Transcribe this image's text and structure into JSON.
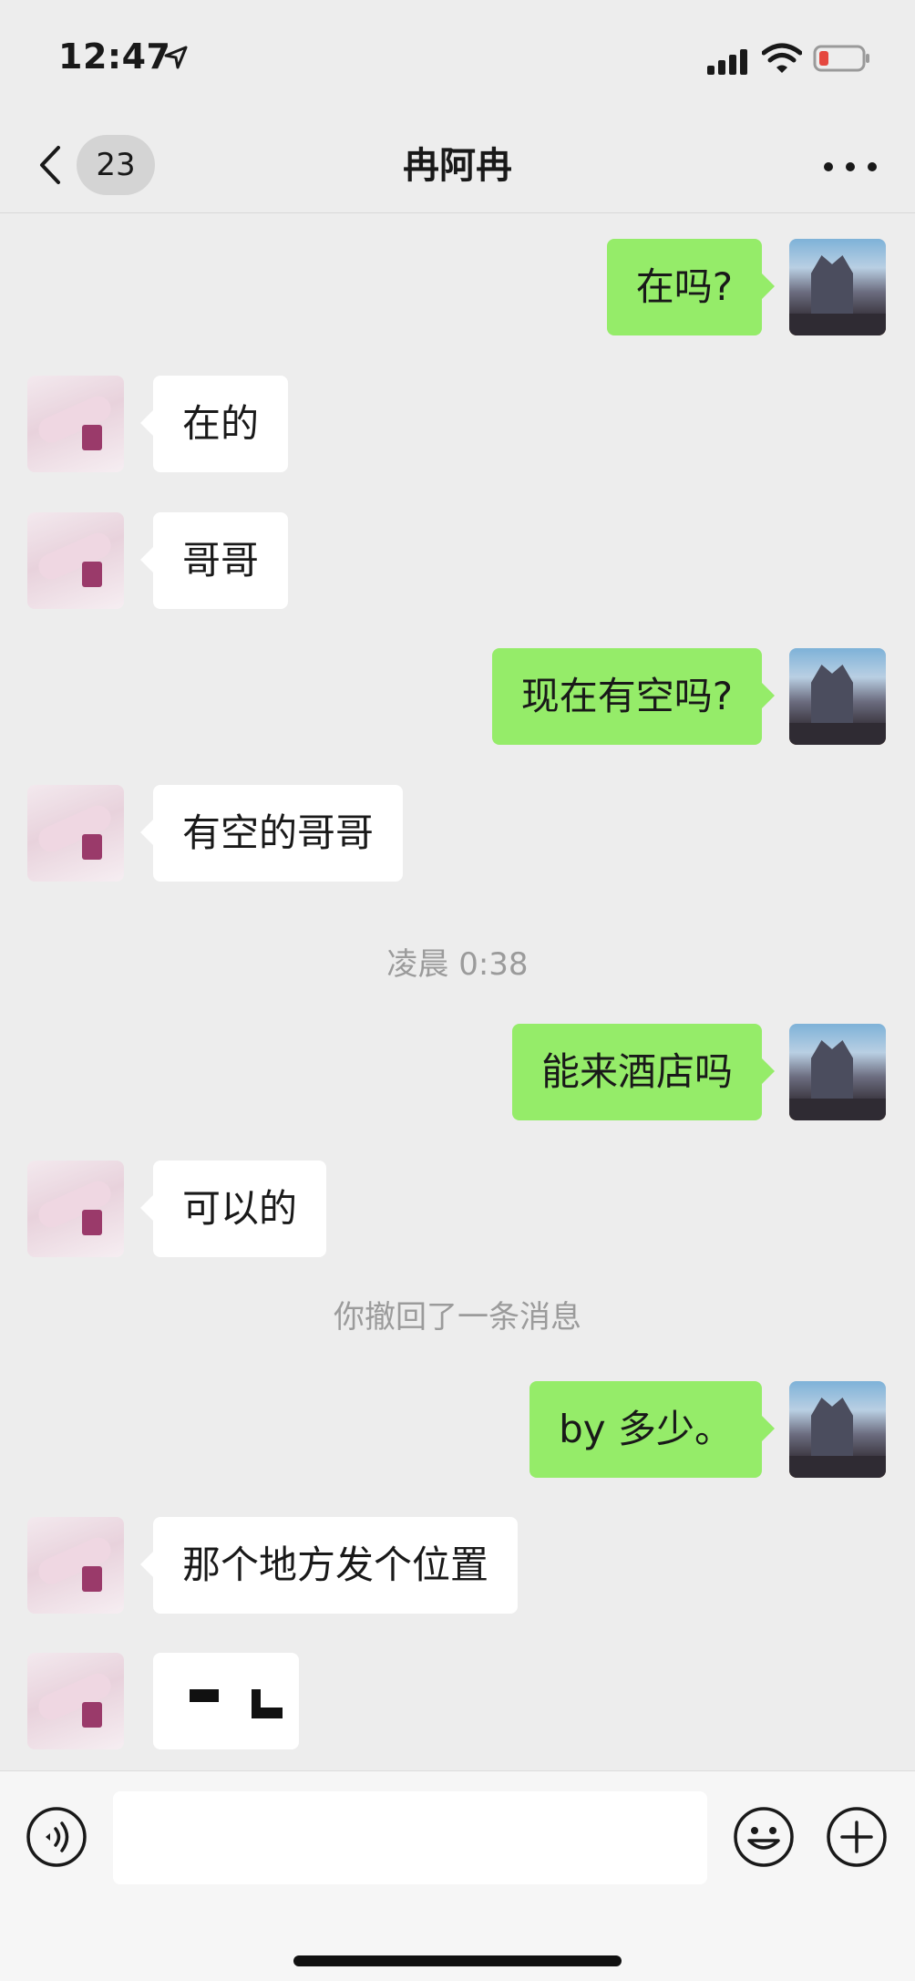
{
  "status_bar": {
    "time": "12:47",
    "icons": [
      "location-arrow-icon",
      "cellular-signal-icon",
      "wifi-icon",
      "battery-low-icon"
    ],
    "battery_color": "#e5483f"
  },
  "nav_bar": {
    "back_icon": "chevron-left-icon",
    "unread_count": "23",
    "title": "冉阿冉",
    "more_icon": "more-dots-icon"
  },
  "colors": {
    "background": "#ededed",
    "sent_bubble": "#95ec69",
    "received_bubble": "#ffffff",
    "system_text": "#9b9b9b"
  },
  "messages": [
    {
      "side": "right",
      "text": "在吗?"
    },
    {
      "side": "left",
      "text": "在的"
    },
    {
      "side": "left",
      "text": "哥哥"
    },
    {
      "side": "right",
      "text": "现在有空吗?"
    },
    {
      "side": "left",
      "text": "有空的哥哥"
    },
    {
      "type": "timestamp",
      "text": "凌晨 0:38"
    },
    {
      "side": "right",
      "text": "能来酒店吗"
    },
    {
      "side": "left",
      "text": "可以的"
    },
    {
      "type": "system",
      "text": "你撤回了一条消息"
    },
    {
      "side": "right",
      "text": "by 多少。"
    },
    {
      "side": "left",
      "text": "那个地方发个位置"
    },
    {
      "side": "left",
      "type": "pending",
      "text": ""
    }
  ],
  "input_bar": {
    "voice_icon": "voice-icon",
    "input_placeholder": "",
    "emoji_icon": "emoji-icon",
    "plus_icon": "plus-icon"
  }
}
